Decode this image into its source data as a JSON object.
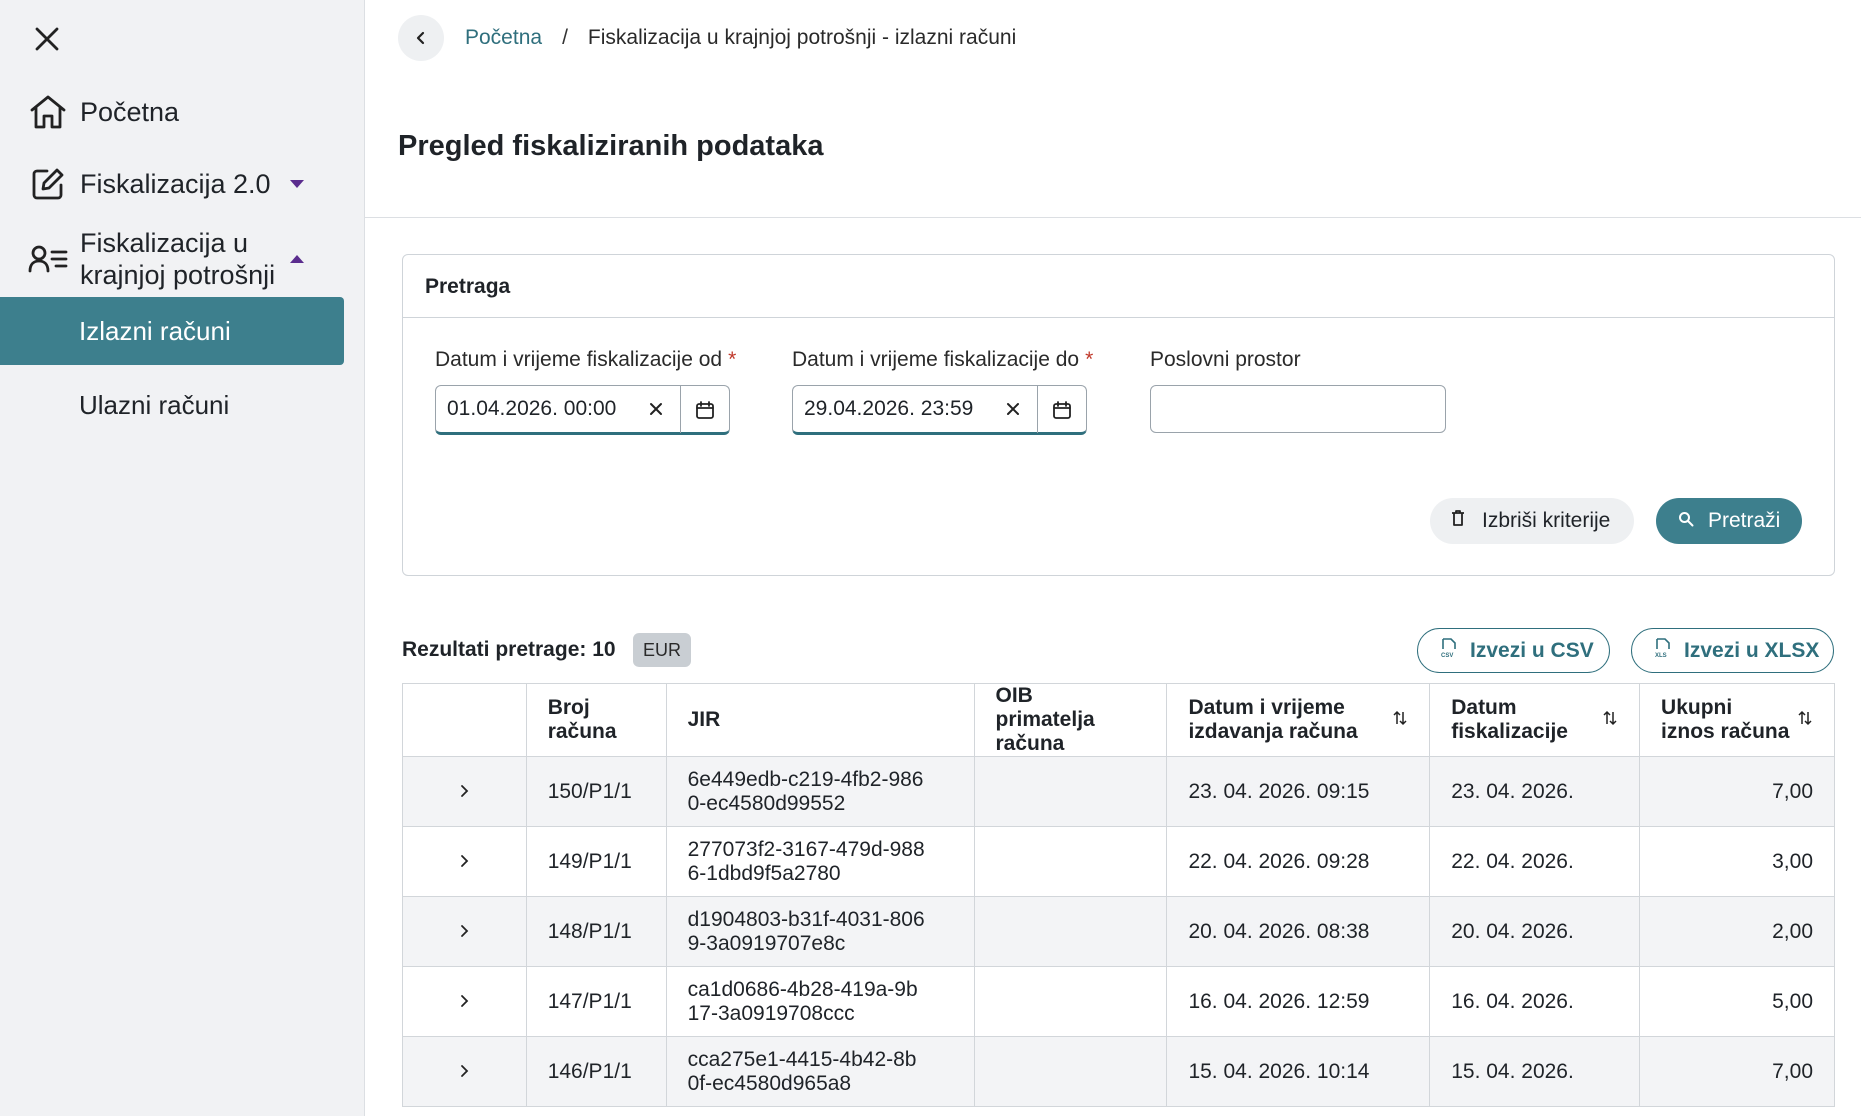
{
  "sidebar": {
    "items": [
      {
        "label": "Početna",
        "icon": "home-icon"
      },
      {
        "label": "Fiskalizacija 2.0",
        "icon": "edit-icon"
      },
      {
        "label": "Fiskalizacija u krajnjoj potrošnji",
        "icon": "user-list-icon"
      }
    ],
    "subitems": [
      {
        "label": "Izlazni računi",
        "active": true
      },
      {
        "label": "Ulazni računi",
        "active": false
      }
    ],
    "accent_color": "#3d7f8d",
    "caret_color": "#5b2d8e"
  },
  "breadcrumb": {
    "home": "Početna",
    "separator": "/",
    "current": "Fiskalizacija u krajnjoj potrošnji - izlazni računi"
  },
  "page_title": "Pregled fiskaliziranih podataka",
  "search": {
    "title": "Pretraga",
    "date_from": {
      "label": "Datum i vrijeme fiskalizacije od",
      "required_mark": "*",
      "value": "01.04.2026. 00:00"
    },
    "date_to": {
      "label": "Datum i vrijeme fiskalizacije do",
      "required_mark": "*",
      "value": "29.04.2026. 23:59"
    },
    "business_premises": {
      "label": "Poslovni prostor",
      "value": ""
    },
    "clear_label": "Izbriši kriterije",
    "search_label": "Pretraži"
  },
  "results": {
    "label": "Rezultati pretrage: 10",
    "currency": "EUR",
    "export_csv": "Izvezi u CSV",
    "export_xlsx": "Izvezi u XLSX",
    "columns": [
      "",
      "Broj računa",
      "JIR",
      "OIB primatelja računa",
      "Datum i vrijeme izdavanja računa",
      "Datum fiskalizacije",
      "Ukupni iznos računa"
    ],
    "rows": [
      {
        "broj": "150/P1/1",
        "jir": "6e449edb-c219-4fb2-9860-ec4580d99552",
        "oib": "",
        "izdano": "23. 04. 2026. 09:15",
        "fisk": "23. 04. 2026.",
        "iznos": "7,00"
      },
      {
        "broj": "149/P1/1",
        "jir": "277073f2-3167-479d-9886-1dbd9f5a2780",
        "oib": "",
        "izdano": "22. 04. 2026. 09:28",
        "fisk": "22. 04. 2026.",
        "iznos": "3,00"
      },
      {
        "broj": "148/P1/1",
        "jir": "d1904803-b31f-4031-8069-3a0919707e8c",
        "oib": "",
        "izdano": "20. 04. 2026. 08:38",
        "fisk": "20. 04. 2026.",
        "iznos": "2,00"
      },
      {
        "broj": "147/P1/1",
        "jir": "ca1d0686-4b28-419a-9b17-3a0919708ccc",
        "oib": "",
        "izdano": "16. 04. 2026. 12:59",
        "fisk": "16. 04. 2026.",
        "iznos": "5,00"
      },
      {
        "broj": "146/P1/1",
        "jir": "cca275e1-4415-4b42-8b0f-ec4580d965a8",
        "oib": "",
        "izdano": "15. 04. 2026. 10:14",
        "fisk": "15. 04. 2026.",
        "iznos": "7,00"
      }
    ]
  }
}
